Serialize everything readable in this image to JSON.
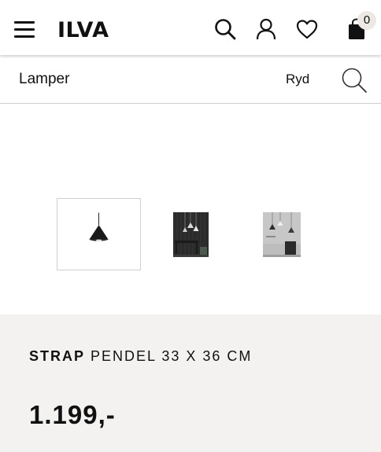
{
  "header": {
    "logo": "ILVA",
    "cart_count": "0",
    "icons": [
      "menu-icon",
      "search-icon",
      "account-icon",
      "heart-icon",
      "shopping-bag-icon"
    ]
  },
  "search": {
    "value": "Lamper",
    "clear_label": "Ryd"
  },
  "gallery": {
    "thumbnails": [
      {
        "name": "pendant-lamp-thumbnail",
        "selected": true
      },
      {
        "name": "room-scene-thumbnail",
        "selected": false
      },
      {
        "name": "grey-room-thumbnail",
        "selected": false
      }
    ]
  },
  "product": {
    "brand": "STRAP",
    "name": " PENDEL 33 X 36 CM",
    "price": "1.199,-"
  },
  "colors": {
    "text": "#111111",
    "info_bg": "#f3f2f0",
    "badge_bg": "#ece9e4",
    "border": "#cfcfcf"
  }
}
